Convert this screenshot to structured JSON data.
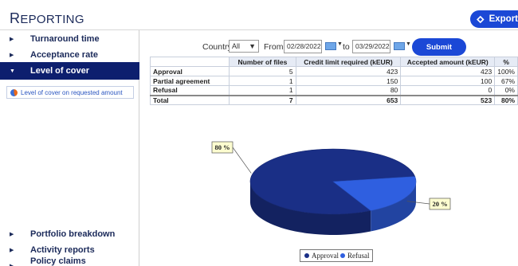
{
  "header": {
    "title_first": "R",
    "title_rest": "EPORTING",
    "export_label": "Export"
  },
  "sidebar": {
    "items_top": [
      {
        "label": "Turnaround time"
      },
      {
        "label": "Acceptance rate"
      },
      {
        "label": "Level of cover",
        "active": true
      }
    ],
    "sub_item": {
      "label": "Level of cover on requested amount"
    },
    "items_bottom": [
      {
        "label": "Portfolio breakdown"
      },
      {
        "label": "Activity reports"
      },
      {
        "label": "Policy claims performance"
      }
    ]
  },
  "filter": {
    "country_label": "Country",
    "country_value": "All",
    "from_label": "From",
    "from_date": "02/28/2022",
    "to_label": "to",
    "to_date": "03/29/2022",
    "submit_label": "Submit"
  },
  "table": {
    "headers": [
      "",
      "Number of files",
      "Credit limit required (kEUR)",
      "Accepted amount (kEUR)",
      "%"
    ],
    "rows": [
      [
        "Approval",
        "5",
        "423",
        "423",
        "100%"
      ],
      [
        "Partial agreement",
        "1",
        "150",
        "100",
        "67%"
      ],
      [
        "Refusal",
        "1",
        "80",
        "0",
        "0%"
      ],
      [
        "Total",
        "7",
        "653",
        "523",
        "80%"
      ]
    ]
  },
  "chart_data": {
    "type": "pie",
    "title": "",
    "slices": [
      {
        "name": "Approval",
        "value": 80,
        "label": "80 %",
        "color": "#1a2f86"
      },
      {
        "name": "Refusal",
        "value": 20,
        "label": "20 %",
        "color": "#2f5fe0"
      }
    ],
    "legend": [
      "Approval",
      "Refusal"
    ],
    "legend_position": "bottom-center"
  }
}
